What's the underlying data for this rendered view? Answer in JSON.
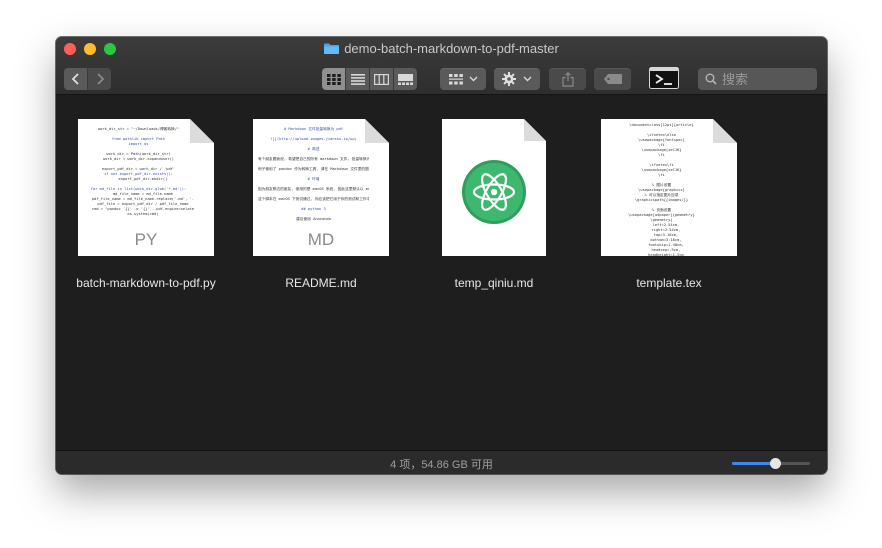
{
  "window": {
    "title": "demo-batch-markdown-to-pdf-master"
  },
  "toolbar": {
    "back_icon": "chevron-left-icon",
    "forward_icon": "chevron-right-icon",
    "view_modes": [
      "icon-view-icon",
      "list-view-icon",
      "column-view-icon",
      "gallery-view-icon"
    ],
    "active_view": 0,
    "group_icon": "group-by-icon",
    "action_icon": "gear-icon",
    "share_icon": "share-icon",
    "tag_icon": "tag-icon",
    "terminal_icon": "terminal-icon",
    "search_placeholder": "搜索"
  },
  "files": [
    {
      "name": "batch-markdown-to-pdf.py",
      "ext": "PY",
      "thumb_lines": [
        {
          "t": "work_dir_str = \"~/Downloads/博客转换/\"",
          "c": "#333"
        },
        {
          "t": "",
          "c": "#333"
        },
        {
          "t": "from pathlib import Path",
          "c": "#3b4fa8"
        },
        {
          "t": "import os",
          "c": "#3b4fa8"
        },
        {
          "t": "",
          "c": "#333"
        },
        {
          "t": "work_dir = Path(work_dir_str)",
          "c": "#333"
        },
        {
          "t": "work_dir = work_dir.expanduser()",
          "c": "#333"
        },
        {
          "t": "",
          "c": "#333"
        },
        {
          "t": "export_pdf_dir = work_dir / 'pdf'",
          "c": "#333"
        },
        {
          "t": "if not export_pdf_dir.exists():",
          "c": "#3b4fa8"
        },
        {
          "t": "    export_pdf_dir.mkdir()",
          "c": "#333"
        },
        {
          "t": "",
          "c": "#333"
        },
        {
          "t": "for md_file in list(work_dir.glob('*.md')):",
          "c": "#3b4fa8"
        },
        {
          "t": "    md_file_name = md_file.name",
          "c": "#333"
        },
        {
          "t": "    pdf_file_name = md_file_name.replace('.md', '.pdf')",
          "c": "#333"
        },
        {
          "t": "    pdf_file = export_pdf_dir / pdf_file_name",
          "c": "#333"
        },
        {
          "t": "    cmd = \"pandoc '{}' -o '{}' --pdf-engine=xelatex\"",
          "c": "#333"
        },
        {
          "t": "    os.system(cmd)",
          "c": "#333"
        }
      ]
    },
    {
      "name": "README.md",
      "ext": "MD",
      "thumb_lines": [
        {
          "t": "# Markdown 文件批量转换为 pdf",
          "c": "#3b4fa8"
        },
        {
          "t": "",
          "c": "#333"
        },
        {
          "t": "![](http://upload-images.jianshu.io/up)",
          "c": "#3b4fa8"
        },
        {
          "t": "",
          "c": "#333"
        },
        {
          "t": "# 简述",
          "c": "#3b4fa8"
        },
        {
          "t": "",
          "c": "#333"
        },
        {
          "t": "有个朋友跟我说, 希望把自己的所有 markdown 文件, 批量转换为 pdf",
          "c": "#333"
        },
        {
          "t": "",
          "c": "#333"
        },
        {
          "t": "例子使用了 pandoc 作为转换工具, 请在 Markdown 文件里的图片",
          "c": "#333"
        },
        {
          "t": "",
          "c": "#333"
        },
        {
          "t": "# 环境",
          "c": "#3b4fa8"
        },
        {
          "t": "",
          "c": "#333"
        },
        {
          "t": "因为朋友那边的朋友, 使用的是 macOS 系统, 因此这里默认以 macOS",
          "c": "#333"
        },
        {
          "t": "",
          "c": "#333"
        },
        {
          "t": "这个脚本在 macOS 下测试通过, 你应该把它用于你的测试和工作中",
          "c": "#333"
        },
        {
          "t": "",
          "c": "#333"
        },
        {
          "t": "## python 3",
          "c": "#3b4fa8"
        },
        {
          "t": "",
          "c": "#333"
        },
        {
          "t": "建议使用 Anaconda",
          "c": "#333"
        }
      ]
    },
    {
      "name": "temp_qiniu.md",
      "ext": "",
      "thumb_icon": "atom-app-icon",
      "thumb_lines": []
    },
    {
      "name": "template.tex",
      "ext": "",
      "thumb_lines": [
        {
          "t": "\\documentclass[12pt]{article}",
          "c": "#333"
        },
        {
          "t": "",
          "c": "#333"
        },
        {
          "t": "\\ifxetex\\else",
          "c": "#333"
        },
        {
          "t": "\\usepackage{fontspec}",
          "c": "#333"
        },
        {
          "t": "\\fi",
          "c": "#333"
        },
        {
          "t": "\\usepackage{xeCJK}",
          "c": "#333"
        },
        {
          "t": "\\fi",
          "c": "#333"
        },
        {
          "t": "",
          "c": "#333"
        },
        {
          "t": "\\ifxetex\\fi",
          "c": "#333"
        },
        {
          "t": "\\usepackage{xeCJK}",
          "c": "#333"
        },
        {
          "t": "\\fi",
          "c": "#333"
        },
        {
          "t": "",
          "c": "#333"
        },
        {
          "t": "% 图片设置",
          "c": "#333"
        },
        {
          "t": "\\usepackage{graphicx}",
          "c": "#333"
        },
        {
          "t": "% 可以指定图片目录",
          "c": "#333"
        },
        {
          "t": "\\graphicspath{{images/}}",
          "c": "#333"
        },
        {
          "t": "",
          "c": "#333"
        },
        {
          "t": "% 页面设置",
          "c": "#333"
        },
        {
          "t": "\\usepackage[a4paper]{geometry}",
          "c": "#333"
        },
        {
          "t": "\\geometry{",
          "c": "#333"
        },
        {
          "t": "    left=2.54cm,",
          "c": "#333"
        },
        {
          "t": "    right=2.54cm,",
          "c": "#333"
        },
        {
          "t": "    top=3.18cm,",
          "c": "#333"
        },
        {
          "t": "    bottom=3.18cm,",
          "c": "#333"
        },
        {
          "t": "    footskip=1.48cm,",
          "c": "#333"
        },
        {
          "t": "    headsep=.5cm,",
          "c": "#333"
        },
        {
          "t": "    headheight=1.5cm",
          "c": "#333"
        }
      ]
    }
  ],
  "status": {
    "text": "4 项，54.86 GB 可用",
    "icon_size_value": 0.55
  },
  "colors": {
    "close": "#fe5f57",
    "minimize": "#febc2e",
    "maximize": "#28c840",
    "slider_accent": "#3e86f5",
    "atom_green": "#3fb86f"
  }
}
